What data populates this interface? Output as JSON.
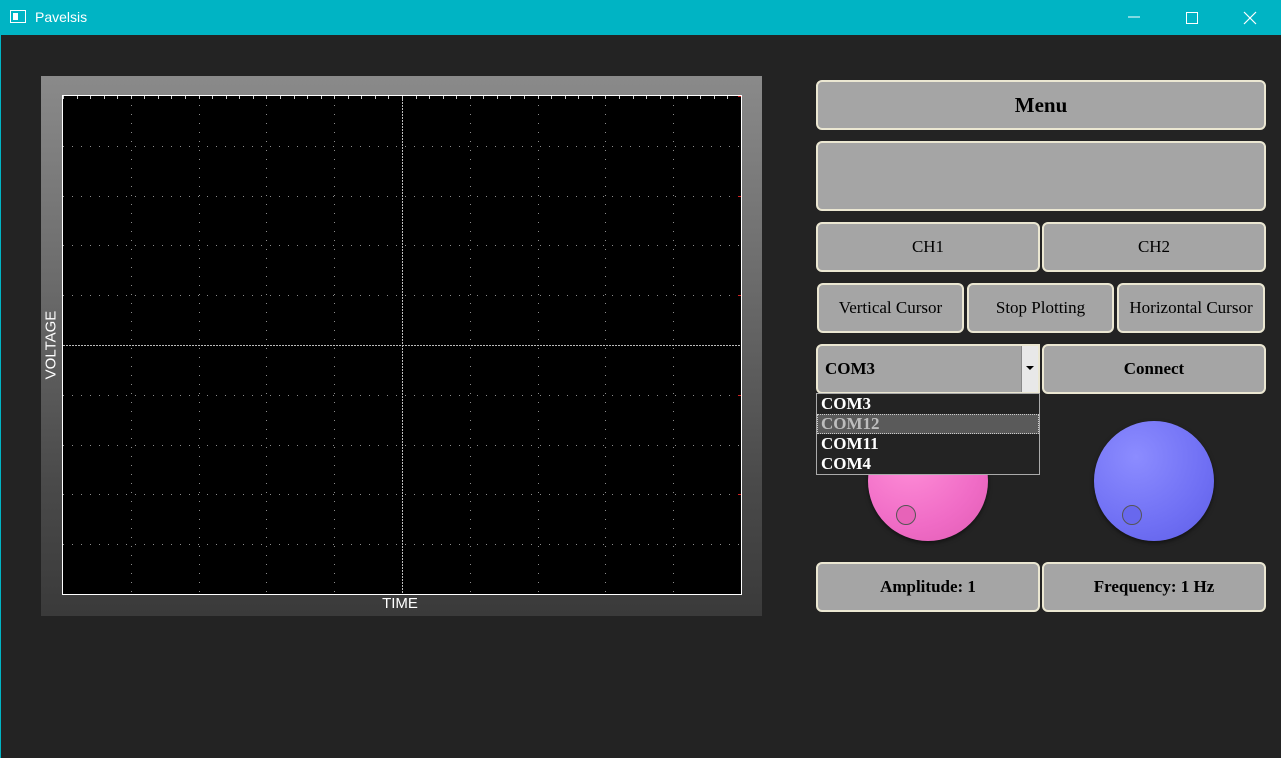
{
  "window": {
    "title": "Pavelsis"
  },
  "plot": {
    "ylabel": "VOLTAGE",
    "xlabel": "TIME"
  },
  "controls": {
    "menu_label": "Menu",
    "display_text": "",
    "ch1_label": "CH1",
    "ch2_label": "CH2",
    "vertical_cursor_label": "Vertical Cursor",
    "stop_plotting_label": "Stop Plotting",
    "horizontal_cursor_label": "Horizontal Cursor",
    "port_selected": "COM3",
    "port_options": [
      "COM3",
      "COM12",
      "COM11",
      "COM4"
    ],
    "port_highlighted": "COM12",
    "connect_label": "Connect",
    "amplitude_label": "Amplitude: 1",
    "frequency_label": "Frequency: 1 Hz"
  },
  "colors": {
    "titlebar": "#00b4c4",
    "background": "#232323",
    "button": "#a5a5a5",
    "amplitude_dial": "#f06cc6",
    "frequency_dial": "#7070f4"
  }
}
